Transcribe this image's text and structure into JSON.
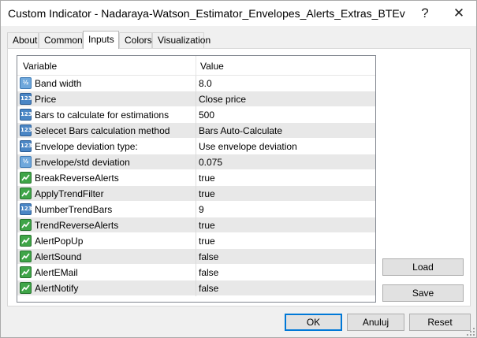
{
  "window": {
    "title": "Custom Indicator - Nadaraya-Watson_Estimator_Envelopes_Alerts_Extras_BTEv",
    "help_glyph": "?",
    "close_glyph": "✕"
  },
  "tabs": [
    {
      "label": "About"
    },
    {
      "label": "Common"
    },
    {
      "label": "Inputs",
      "active": true
    },
    {
      "label": "Colors"
    },
    {
      "label": "Visualization"
    }
  ],
  "grid": {
    "header_variable": "Variable",
    "header_value": "Value",
    "rows": [
      {
        "variable": "Band width",
        "value": "8.0",
        "icon": "double-type-icon"
      },
      {
        "variable": "Price",
        "value": "Close price",
        "icon": "int-type-icon"
      },
      {
        "variable": "Bars to calculate for estimations",
        "value": "500",
        "icon": "int-type-icon"
      },
      {
        "variable": "Selecet Bars calculation method",
        "value": "Bars Auto-Calculate",
        "icon": "int-type-icon"
      },
      {
        "variable": "Envelope deviation type:",
        "value": "Use envelope deviation",
        "icon": "int-type-icon"
      },
      {
        "variable": "Envelope/std deviation",
        "value": "0.075",
        "icon": "double-type-icon"
      },
      {
        "variable": "BreakReverseAlerts",
        "value": "true",
        "icon": "bool-type-icon"
      },
      {
        "variable": "ApplyTrendFilter",
        "value": "true",
        "icon": "bool-type-icon"
      },
      {
        "variable": "NumberTrendBars",
        "value": "9",
        "icon": "int-type-icon"
      },
      {
        "variable": "TrendReverseAlerts",
        "value": "true",
        "icon": "bool-type-icon"
      },
      {
        "variable": "AlertPopUp",
        "value": "true",
        "icon": "bool-type-icon"
      },
      {
        "variable": "AlertSound",
        "value": "false",
        "icon": "bool-type-icon"
      },
      {
        "variable": "AlertEMail",
        "value": "false",
        "icon": "bool-type-icon"
      },
      {
        "variable": "AlertNotify",
        "value": "false",
        "icon": "bool-type-icon"
      }
    ]
  },
  "icons": {
    "int_text": "123",
    "double_text": "½"
  },
  "buttons": {
    "load": "Load",
    "save": "Save",
    "ok": "OK",
    "cancel": "Anuluj",
    "reset": "Reset"
  },
  "colors": {
    "accent": "#0078d7",
    "alt_row": "#e8e8e8",
    "int_icon": "#4a86c5",
    "bool_icon": "#3fa548"
  }
}
